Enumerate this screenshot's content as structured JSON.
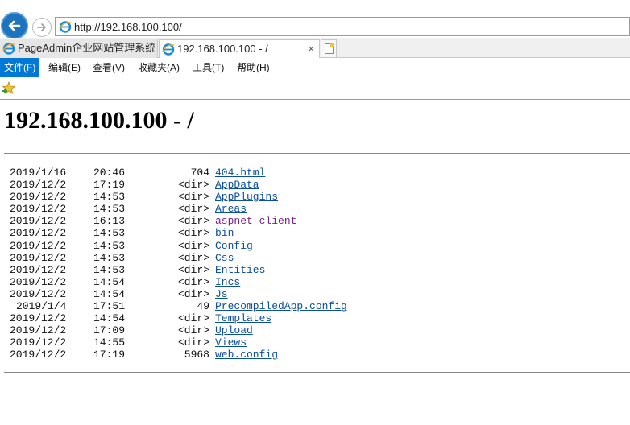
{
  "browser": {
    "url": "http://192.168.100.100/",
    "tabs": [
      {
        "label": "PageAdmin企业网站管理系统",
        "active": false
      },
      {
        "label": "192.168.100.100 - /",
        "active": true,
        "close": "×"
      }
    ],
    "menu": [
      "文件(F)",
      "编辑(E)",
      "查看(V)",
      "收藏夹(A)",
      "工具(T)",
      "帮助(H)"
    ],
    "accent_color": "#0078d7"
  },
  "page": {
    "title": "192.168.100.100 - /",
    "entries": [
      {
        "date": "2019/1/16",
        "time": "20:46",
        "size": "704",
        "name": "404.html",
        "visited": false
      },
      {
        "date": "2019/12/2",
        "time": "17:19",
        "size": "<dir>",
        "name": "AppData",
        "visited": false
      },
      {
        "date": "2019/12/2",
        "time": "14:53",
        "size": "<dir>",
        "name": "AppPlugins",
        "visited": false
      },
      {
        "date": "2019/12/2",
        "time": "14:53",
        "size": "<dir>",
        "name": "Areas",
        "visited": false
      },
      {
        "date": "2019/12/2",
        "time": "16:13",
        "size": "<dir>",
        "name": "aspnet_client",
        "visited": true
      },
      {
        "date": "2019/12/2",
        "time": "14:53",
        "size": "<dir>",
        "name": "bin",
        "visited": false
      },
      {
        "date": "2019/12/2",
        "time": "14:53",
        "size": "<dir>",
        "name": "Config",
        "visited": false
      },
      {
        "date": "2019/12/2",
        "time": "14:53",
        "size": "<dir>",
        "name": "Css",
        "visited": false
      },
      {
        "date": "2019/12/2",
        "time": "14:53",
        "size": "<dir>",
        "name": "Entities",
        "visited": false
      },
      {
        "date": "2019/12/2",
        "time": "14:54",
        "size": "<dir>",
        "name": "Incs",
        "visited": false
      },
      {
        "date": "2019/12/2",
        "time": "14:54",
        "size": "<dir>",
        "name": "Js",
        "visited": false
      },
      {
        "date": "2019/1/4",
        "time": "17:51",
        "size": "49",
        "name": "PrecompiledApp.config",
        "visited": false
      },
      {
        "date": "2019/12/2",
        "time": "14:54",
        "size": "<dir>",
        "name": "Templates",
        "visited": false
      },
      {
        "date": "2019/12/2",
        "time": "17:09",
        "size": "<dir>",
        "name": "Upload",
        "visited": false
      },
      {
        "date": "2019/12/2",
        "time": "14:55",
        "size": "<dir>",
        "name": "Views",
        "visited": false
      },
      {
        "date": "2019/12/2",
        "time": "17:19",
        "size": "5968",
        "name": "web.config",
        "visited": false
      }
    ]
  }
}
